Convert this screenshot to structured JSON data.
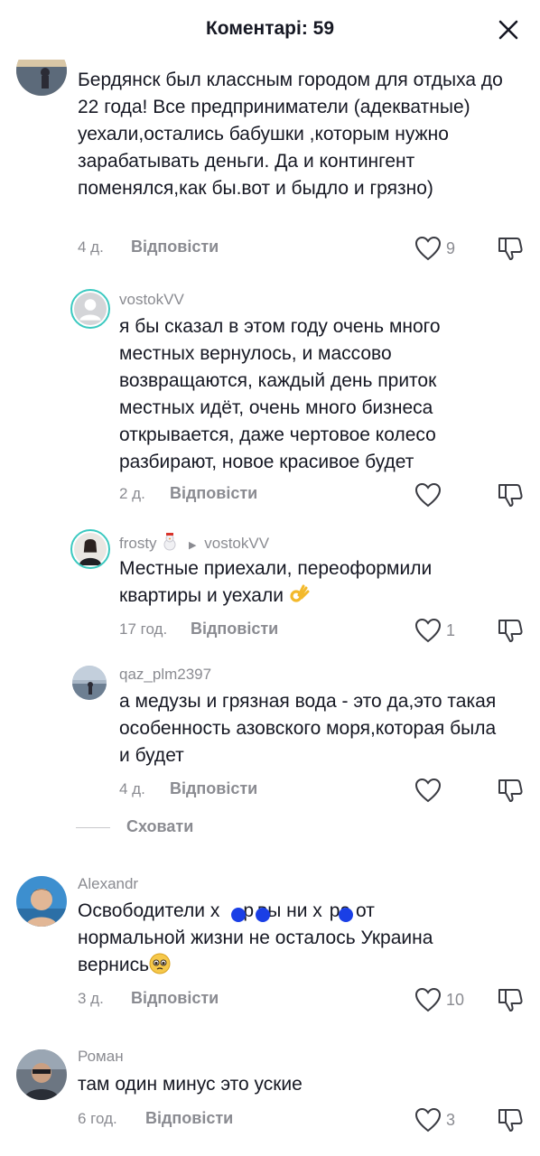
{
  "header": {
    "title": "Коментарі: 59",
    "close_icon": "close-icon"
  },
  "reply_label": "Відповісти",
  "hide_label": "Сховати",
  "comments": [
    {
      "username": "",
      "text": "Бердянск был классным городом для отдыха до 22 года! Все предприниматели (адекватные) уехали,остались бабушки ,которым нужно зарабатывать деньги. Да и контингент поменялся,как бы.вот и быдло и грязно)",
      "time": "4 д.",
      "likes": "9"
    },
    {
      "username": "vostokVV",
      "text": "я бы сказал в этом году очень много местных вернулось, и массово возвращаются, каждый день приток местных идёт, очень много бизнеса открывается, даже чертовое колесо разбирают, новое красивое будет",
      "time": "2 д.",
      "likes": ""
    },
    {
      "username": "frosty",
      "reply_to": "vostokVV",
      "text": "Местные приехали, переоформили квартиры и уехали",
      "time": "17 год.",
      "likes": "1"
    },
    {
      "username": "qaz_plm2397",
      "text": "а медузы и грязная вода - это да,это такая особенность азовского моря,которая была и будет",
      "time": "4 д.",
      "likes": ""
    },
    {
      "username": "Alexandr",
      "text_line1a": "Освободители х",
      "text_line1b": "р",
      "text_line1c": "вы ни х",
      "text_line1d": "ра от",
      "text_rest": "нормальной жизни не осталось Украина вернись",
      "time": "3 д.",
      "likes": "10"
    },
    {
      "username": "Роман",
      "text": "там один минус это уские",
      "time": "6 год.",
      "likes": "3"
    }
  ],
  "colors": {
    "text": "#161823",
    "muted": "#8a8b91",
    "censor_dot": "#1a3fe6"
  }
}
